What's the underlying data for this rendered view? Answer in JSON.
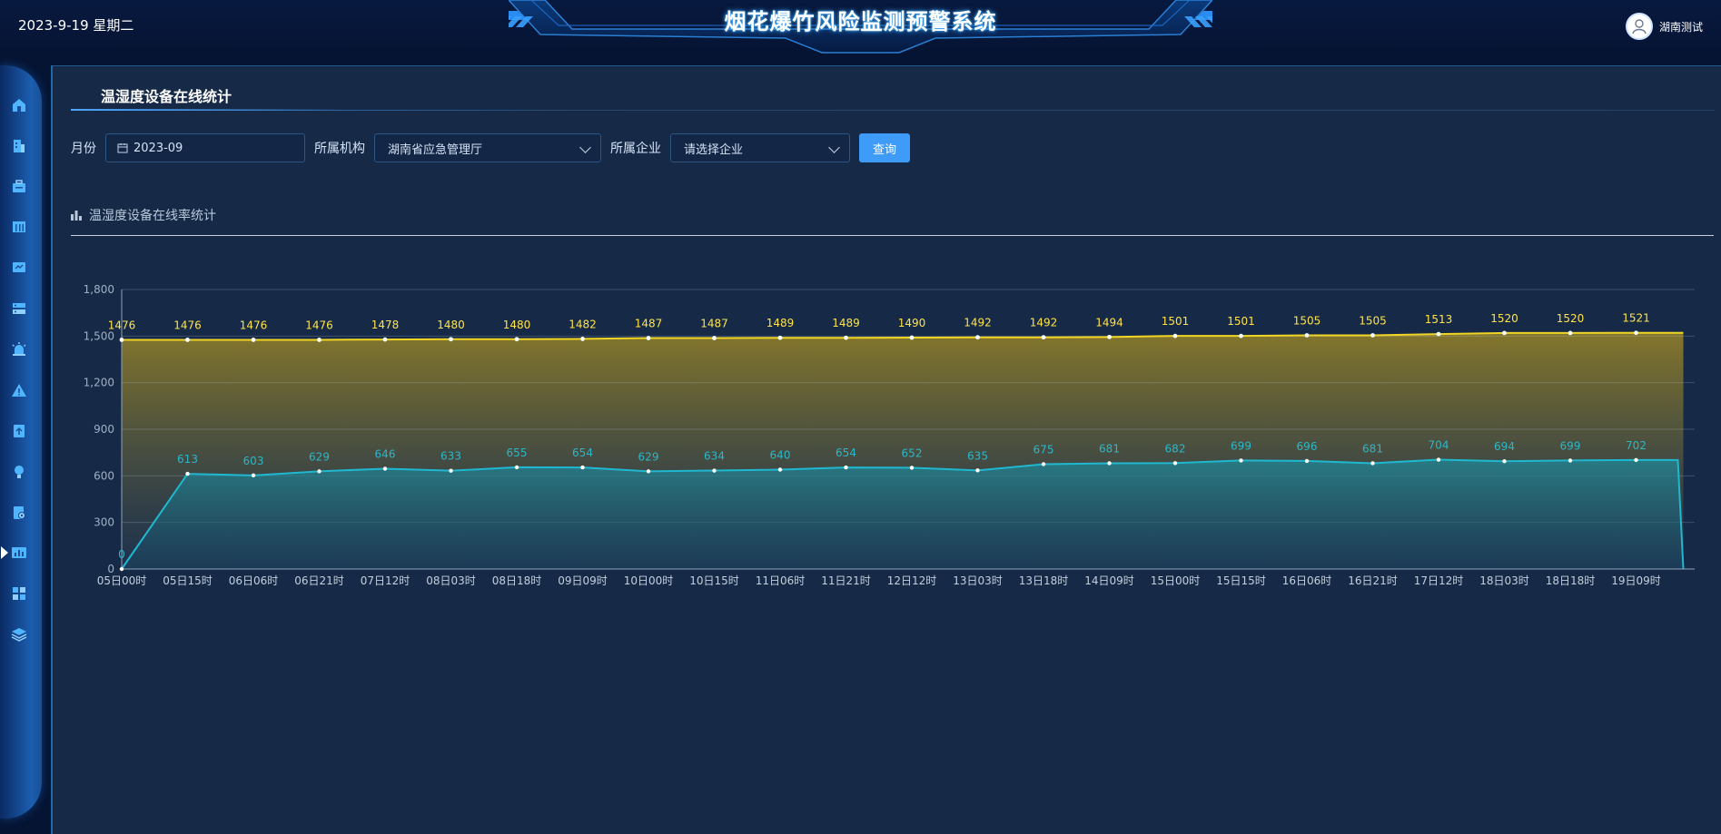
{
  "header": {
    "date": "2023-9-19 星期二",
    "title": "烟花爆竹风险监测预警系统",
    "user_name": "湖南测试"
  },
  "sidebar": {
    "items": [
      {
        "icon": "home-icon"
      },
      {
        "icon": "building-icon"
      },
      {
        "icon": "briefcase-icon"
      },
      {
        "icon": "grid-table-icon"
      },
      {
        "icon": "monitor-screen-icon"
      },
      {
        "icon": "server-icon"
      },
      {
        "icon": "alarm-light-icon"
      },
      {
        "icon": "warning-triangle-icon"
      },
      {
        "icon": "document-upload-icon"
      },
      {
        "icon": "lightbulb-icon"
      },
      {
        "icon": "document-settings-icon"
      },
      {
        "icon": "bar-chart-icon",
        "active": true
      },
      {
        "icon": "apps-icon"
      },
      {
        "icon": "layers-icon"
      }
    ]
  },
  "panel": {
    "title": "温湿度设备在线统计",
    "filters": {
      "month_label": "月份",
      "month_value": "2023-09",
      "org_label": "所属机构",
      "org_value": "湖南省应急管理厅",
      "enterprise_label": "所属企业",
      "enterprise_placeholder": "请选择企业",
      "query_button": "查询"
    },
    "chart_section_title": "温湿度设备在线率统计"
  },
  "colors": {
    "total_line": "#f0d524",
    "online_line": "#1fb8d0",
    "label_total": "#ffe34a",
    "label_online": "#2bb7c9"
  },
  "chart_data": {
    "type": "area",
    "title": "",
    "xlabel": "",
    "ylabel": "",
    "ylim": [
      0,
      1800
    ],
    "yticks": [
      "0",
      "300",
      "600",
      "900",
      "1,200",
      "1,500",
      "1,800"
    ],
    "grid": true,
    "legend": "none",
    "categories": [
      "05日00时",
      "05日15时",
      "06日06时",
      "06日21时",
      "07日12时",
      "08日03时",
      "08日18时",
      "09日09时",
      "10日00时",
      "10日15时",
      "11日06时",
      "11日21时",
      "12日12时",
      "13日03时",
      "13日18时",
      "14日09时",
      "15日00时",
      "15日15时",
      "16日06时",
      "16日21时",
      "17日12时",
      "18日03时",
      "18日18时",
      "19日09时"
    ],
    "series": [
      {
        "values": [
          1476,
          1476,
          1476,
          1476,
          1478,
          1480,
          1480,
          1482,
          1487,
          1487,
          1489,
          1489,
          1490,
          1492,
          1492,
          1494,
          1501,
          1501,
          1505,
          1505,
          1513,
          1520,
          1520,
          1521
        ],
        "end_value": 1521
      },
      {
        "values": [
          0,
          613,
          603,
          629,
          646,
          633,
          655,
          654,
          629,
          634,
          640,
          654,
          652,
          635,
          675,
          681,
          682,
          699,
          696,
          681,
          704,
          694,
          699,
          702
        ],
        "end_value": 0
      }
    ]
  }
}
